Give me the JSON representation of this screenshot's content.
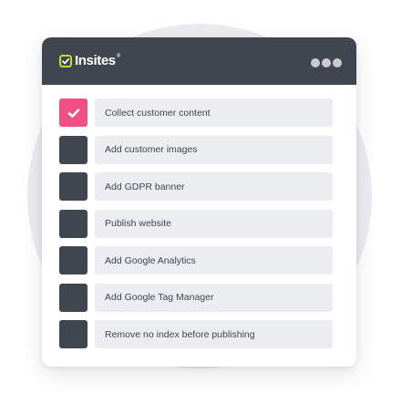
{
  "app": {
    "logo_text": "Insites",
    "logo_mark": "®"
  },
  "window_controls": {
    "icon": "more-dots-icon"
  },
  "checklist": {
    "items": [
      {
        "label": "Collect customer content",
        "checked": true
      },
      {
        "label": "Add customer images",
        "checked": false
      },
      {
        "label": "Add GDPR banner",
        "checked": false
      },
      {
        "label": "Publish website",
        "checked": false
      },
      {
        "label": "Add Google Analytics",
        "checked": false
      },
      {
        "label": "Add Google Tag Manager",
        "checked": false
      },
      {
        "label": "Remove no index before publishing",
        "checked": false
      }
    ]
  },
  "colors": {
    "titlebar": "#3f4650",
    "checked": "#ee4f84",
    "unchecked": "#3f4650",
    "task_bg": "#ecedf1",
    "logo_accent": "#c6d92d"
  }
}
